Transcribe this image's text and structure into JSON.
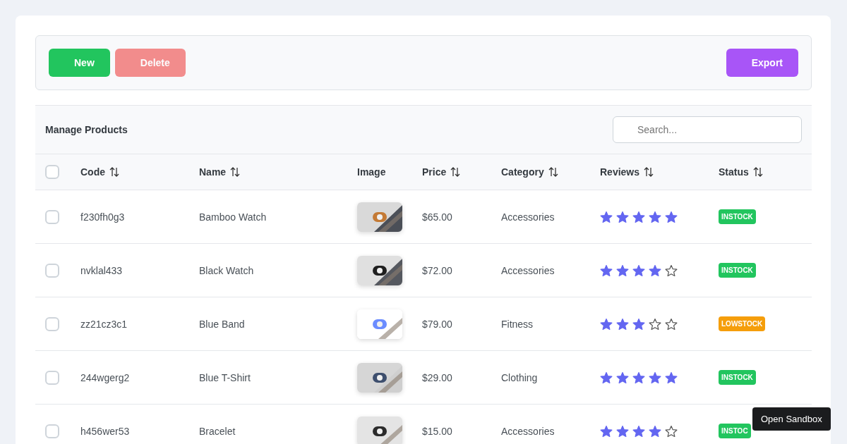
{
  "toolbar": {
    "left_buttons": [
      {
        "label": "New",
        "kind": "success",
        "disabled": false
      },
      {
        "label": "Delete",
        "kind": "danger",
        "disabled": true
      }
    ],
    "right_buttons": [
      {
        "label": "Export",
        "kind": "help",
        "disabled": false
      }
    ]
  },
  "table": {
    "title": "Manage Products",
    "search": {
      "placeholder": "Search..."
    },
    "select_all": {
      "checked": false
    },
    "columns": [
      {
        "label": "Code",
        "sortable": true
      },
      {
        "label": "Name",
        "sortable": true
      },
      {
        "label": "Image",
        "sortable": false
      },
      {
        "label": "Price",
        "sortable": true
      },
      {
        "label": "Category",
        "sortable": true
      },
      {
        "label": "Reviews",
        "sortable": true
      },
      {
        "label": "Status",
        "sortable": true
      }
    ],
    "rows": [
      {
        "selected": false,
        "code": "f230fh0g3",
        "name": "Bamboo Watch",
        "price": "$65.00",
        "category": "Accessories",
        "stars": 5,
        "status": {
          "label": "INSTOCK",
          "color": "#22c55e"
        }
      },
      {
        "selected": false,
        "code": "nvklal433",
        "name": "Black Watch",
        "price": "$72.00",
        "category": "Accessories",
        "stars": 4,
        "status": {
          "label": "INSTOCK",
          "color": "#22c55e"
        }
      },
      {
        "selected": false,
        "code": "zz21cz3c1",
        "name": "Blue Band",
        "price": "$79.00",
        "category": "Fitness",
        "stars": 3,
        "status": {
          "label": "LOWSTOCK",
          "color": "#f59e0b"
        }
      },
      {
        "selected": false,
        "code": "244wgerg2",
        "name": "Blue T-Shirt",
        "price": "$29.00",
        "category": "Clothing",
        "stars": 5,
        "status": {
          "label": "INSTOCK",
          "color": "#22c55e"
        }
      },
      {
        "selected": false,
        "code": "h456wer53",
        "name": "Bracelet",
        "price": "$15.00",
        "category": "Accessories",
        "stars": 4,
        "status": {
          "label": "INSTOC",
          "color": "#22c55e"
        }
      }
    ]
  },
  "tooltip": {
    "text": "Open Sandbox"
  }
}
